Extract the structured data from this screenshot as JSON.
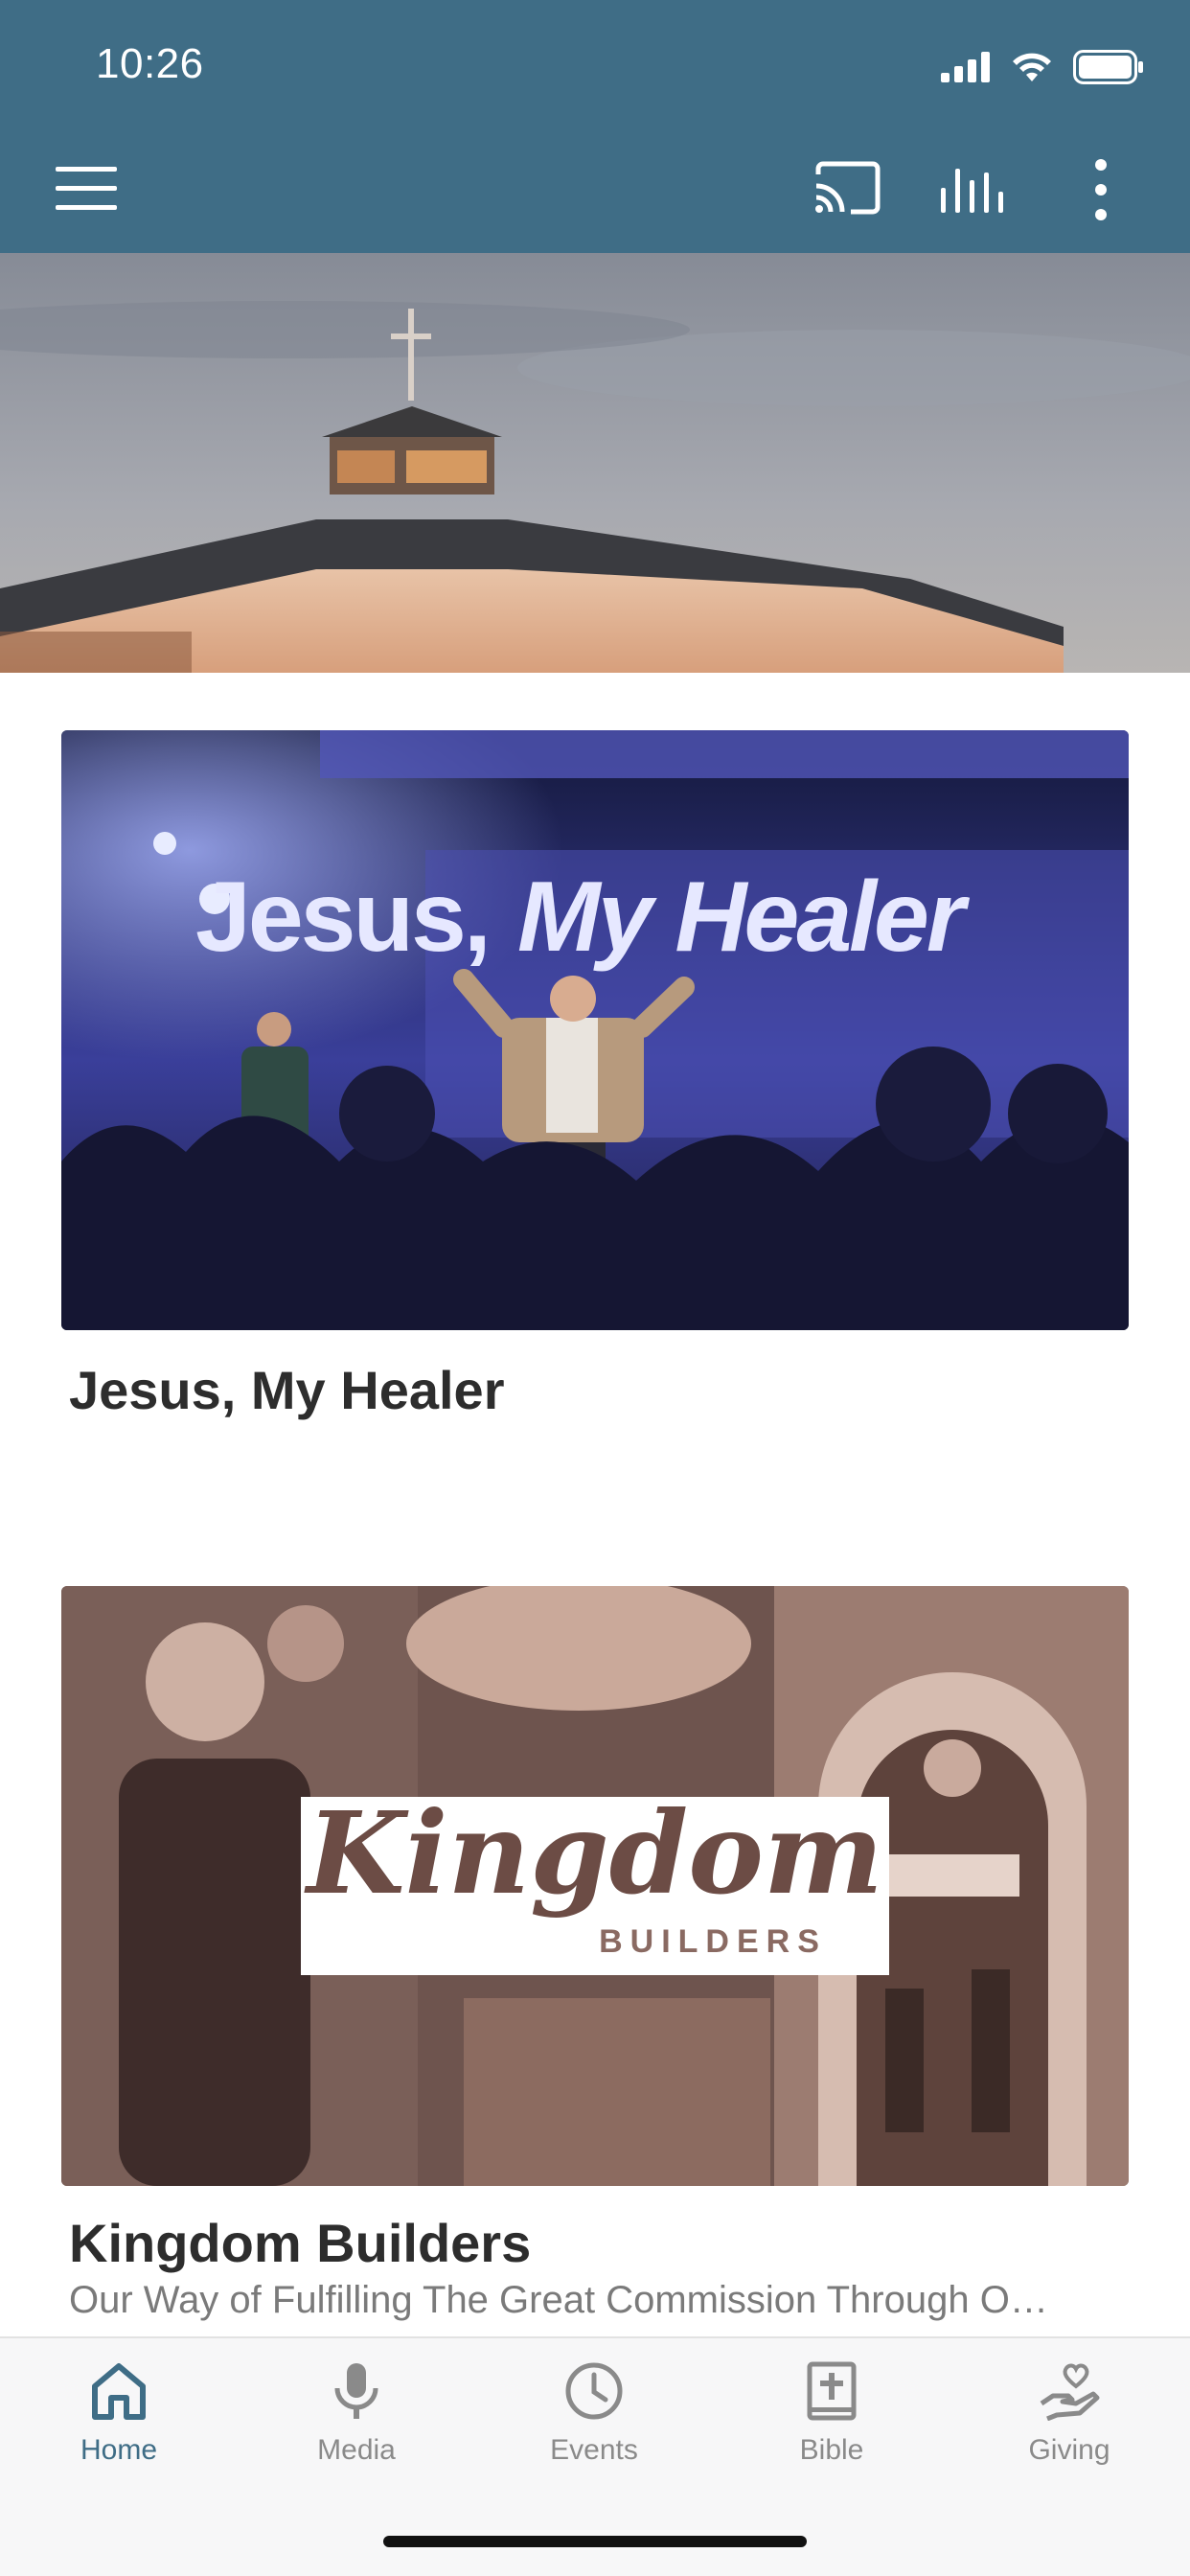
{
  "status_bar": {
    "time": "10:26"
  },
  "toolbar": {
    "menu_icon": "hamburger-menu-icon",
    "cast_icon": "cast-icon",
    "equalizer_icon": "equalizer-icon",
    "more_icon": "more-vertical-icon"
  },
  "colors": {
    "header": "#3f6d86",
    "accent": "#3f6d86",
    "inactive": "#8a8a8a"
  },
  "cards": [
    {
      "image_text": [
        "Jesus,",
        "My Healer"
      ],
      "title": "Jesus, My Healer"
    },
    {
      "image_text": [
        "Kingdom",
        "BUILDERS"
      ],
      "title": "Kingdom Builders",
      "subtitle": "Our Way of Fulfilling The Great Commission Through O…"
    }
  ],
  "tabs": [
    {
      "label": "Home",
      "icon": "home-icon",
      "active": true
    },
    {
      "label": "Media",
      "icon": "microphone-icon"
    },
    {
      "label": "Events",
      "icon": "clock-icon"
    },
    {
      "label": "Bible",
      "icon": "bible-icon"
    },
    {
      "label": "Giving",
      "icon": "giving-heart-hand-icon"
    }
  ]
}
